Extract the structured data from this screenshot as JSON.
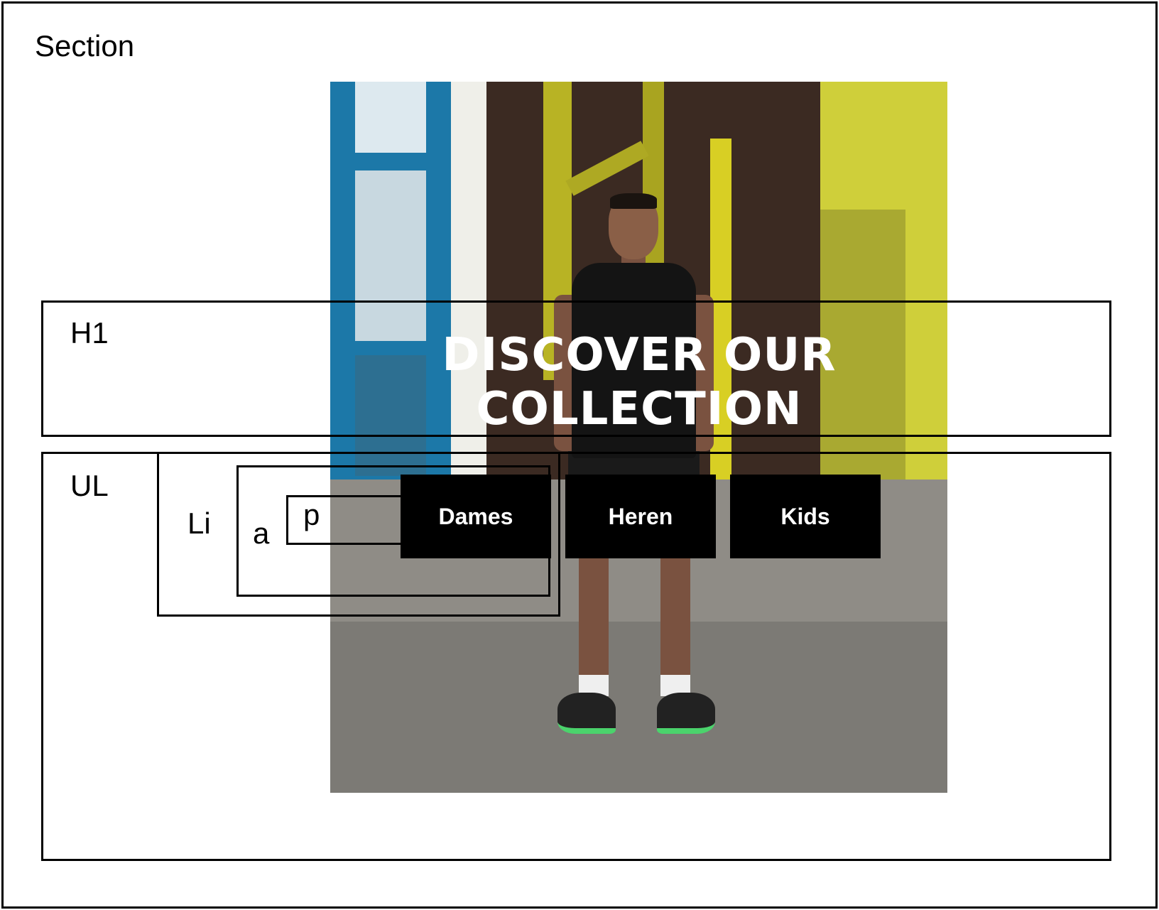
{
  "diagram": {
    "labels": {
      "section": "Section",
      "h1": "H1",
      "ul": "UL",
      "li": "Li",
      "a": "a",
      "p": "p"
    },
    "hero": {
      "heading_line1": "DISCOVER OUR",
      "heading_line2": "COLLECTION"
    },
    "nav_buttons": [
      "Dames",
      "Heren",
      "Kids"
    ],
    "colors": {
      "outline": "#000000",
      "button_bg": "#000000",
      "button_text": "#ffffff",
      "heading_text": "#ffffff"
    }
  }
}
